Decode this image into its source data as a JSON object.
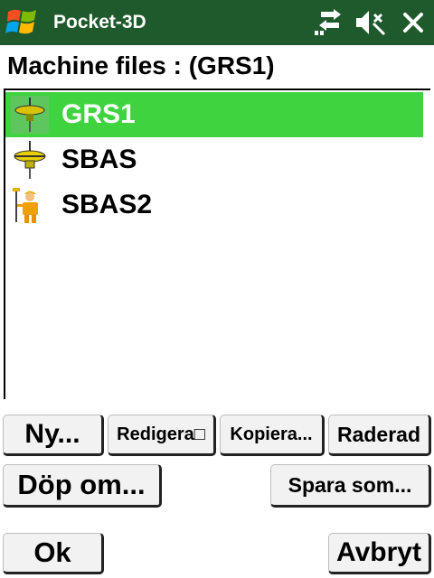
{
  "window": {
    "title": "Pocket-3D",
    "icons": [
      "windows-start-icon",
      "sync-icon",
      "sound-icon",
      "close-icon"
    ],
    "title_bar_color": "#1f5a2c"
  },
  "heading": "Machine files : (GRS1)",
  "files": {
    "items": [
      {
        "label": "GRS1",
        "icon": "gnss-receiver-icon",
        "selected": true
      },
      {
        "label": "SBAS",
        "icon": "gnss-receiver-icon",
        "selected": false
      },
      {
        "label": "SBAS2",
        "icon": "surveyor-icon",
        "selected": false
      }
    ],
    "selection_color": "#3fd43f"
  },
  "buttons": {
    "new": "Ny...",
    "edit": "Redigera□",
    "copy": "Kopiera...",
    "delete": "Raderad",
    "rename": "Döp om...",
    "save_as": "Spara som...",
    "ok": "Ok",
    "cancel": "Avbryt"
  }
}
